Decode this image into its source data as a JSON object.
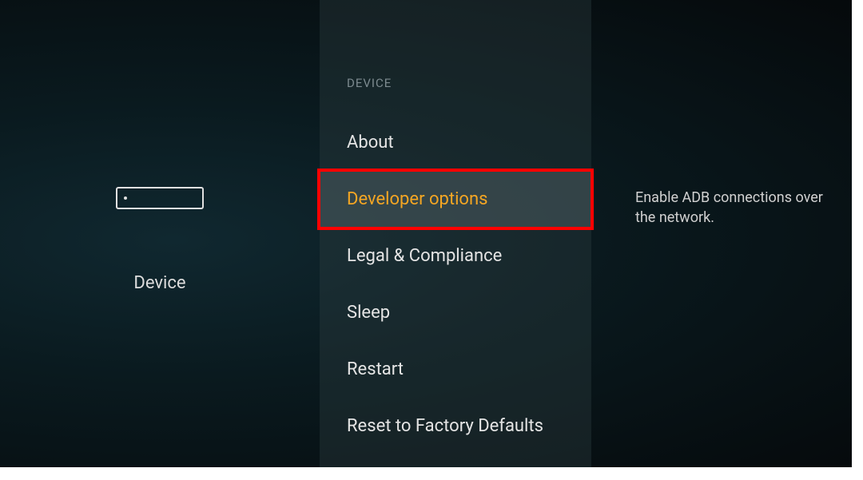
{
  "left": {
    "label": "Device"
  },
  "middle": {
    "header": "DEVICE",
    "items": [
      {
        "label": "About",
        "selected": false
      },
      {
        "label": "Developer options",
        "selected": true
      },
      {
        "label": "Legal & Compliance",
        "selected": false
      },
      {
        "label": "Sleep",
        "selected": false
      },
      {
        "label": "Restart",
        "selected": false
      },
      {
        "label": "Reset to Factory Defaults",
        "selected": false
      }
    ]
  },
  "right": {
    "description": "Enable ADB connections over the network."
  }
}
